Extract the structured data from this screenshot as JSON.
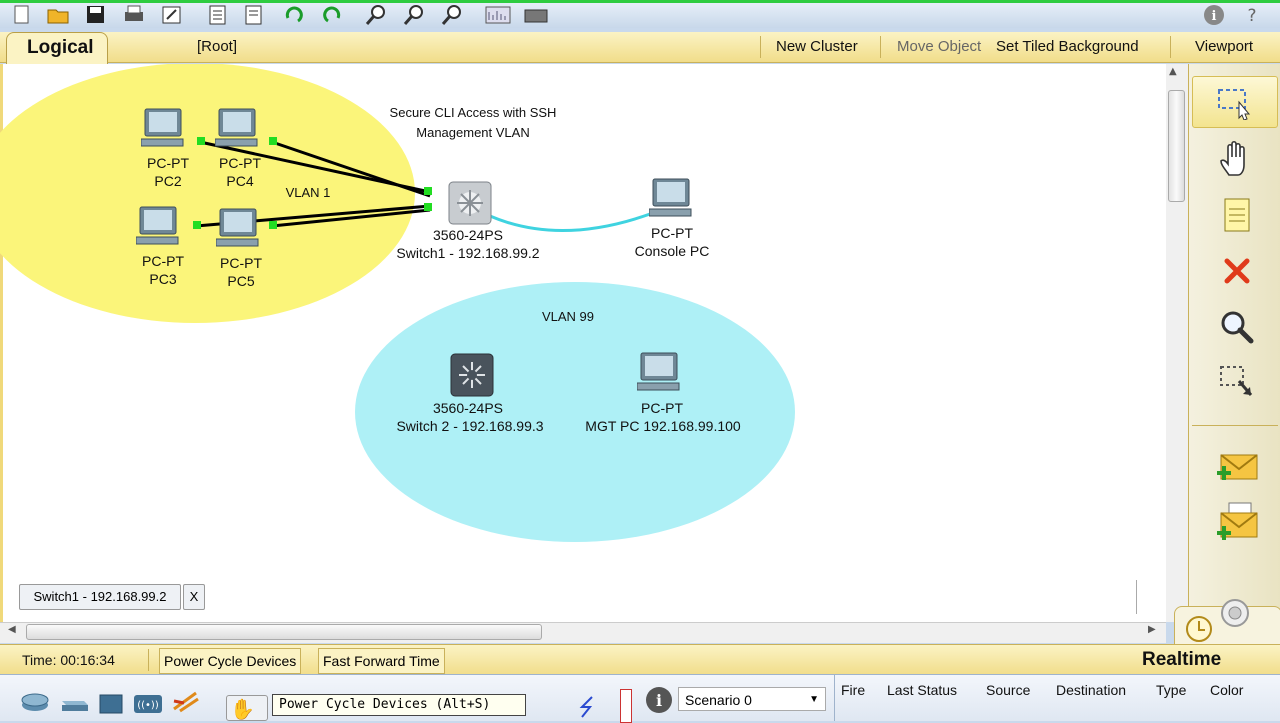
{
  "toolbar": {
    "icons": [
      "new-file-icon",
      "open-folder-icon",
      "save-icon",
      "print-icon",
      "activity-wizard-icon",
      "document-icon",
      "document-edit-icon",
      "undo-icon",
      "redo-icon",
      "zoom-in-icon",
      "zoom-reset-icon",
      "zoom-out-icon",
      "palette-icon",
      "custom-device-icon",
      "info-icon",
      "help-icon"
    ]
  },
  "logical_bar": {
    "tab_label": "Logical",
    "root": "[Root]",
    "new_cluster": "New Cluster",
    "move_object": "Move Object",
    "set_tiled_background": "Set Tiled Background",
    "viewport": "Viewport"
  },
  "canvas": {
    "note_title": "Secure CLI Access with SSH",
    "note_subtitle": "Management VLAN",
    "vlan1_label": "VLAN 1",
    "vlan99_label": "VLAN 99",
    "devices": {
      "pc2": {
        "type": "PC-PT",
        "name": "PC2"
      },
      "pc4": {
        "type": "PC-PT",
        "name": "PC4"
      },
      "pc3": {
        "type": "PC-PT",
        "name": "PC3"
      },
      "pc5": {
        "type": "PC-PT",
        "name": "PC5"
      },
      "switch1": {
        "type": "3560-24PS",
        "name": "Switch1 - 192.168.99.2"
      },
      "console_pc": {
        "type": "PC-PT",
        "name": "Console PC"
      },
      "switch2": {
        "type": "3560-24PS",
        "name": "Switch 2 - 192.168.99.3"
      },
      "mgt_pc": {
        "type": "PC-PT",
        "name": "MGT PC 192.168.99.100"
      }
    },
    "link_colors": {
      "ethernet": "#000000",
      "console": "#3fd3e0",
      "port_up": "#22dd22"
    },
    "area_colors": {
      "vlan1": "#fbf57a",
      "vlan99": "#aef0f6"
    },
    "open_window_tab": "Switch1 - 192.168.99.2",
    "open_window_close": "X"
  },
  "right_panel": {
    "tools": [
      "select-icon",
      "hand-move-icon",
      "note-icon",
      "delete-icon",
      "inspect-icon",
      "resize-select-icon",
      "add-simple-pdu-icon",
      "add-complex-pdu-icon"
    ]
  },
  "time_bar": {
    "time": "Time: 00:16:34",
    "power_cycle": "Power Cycle Devices",
    "fast_forward": "Fast Forward Time",
    "mode": "Realtime"
  },
  "bottom": {
    "tooltip": "Power Cycle Devices (Alt+S)",
    "scenario": "Scenario 0",
    "columns": [
      "Fire",
      "Last Status",
      "Source",
      "Destination",
      "Type",
      "Color"
    ]
  }
}
